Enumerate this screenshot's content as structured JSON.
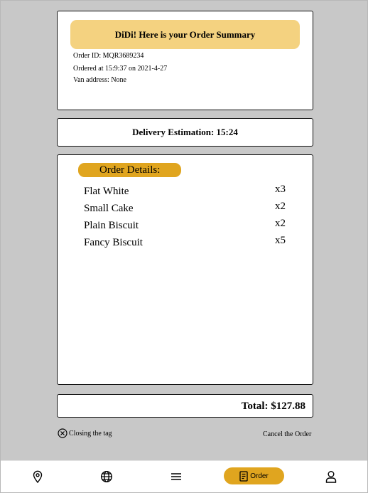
{
  "summary": {
    "title": "DiDi! Here is your Order Summary",
    "order_id": "Order ID: MQR3689234",
    "ordered_at": "Ordered at 15:9:37 on 2021-4-27",
    "van_address": "Van address: None"
  },
  "delivery": {
    "text": "Delivery Estimation: 15:24"
  },
  "details": {
    "heading": "Order Details:",
    "items": [
      {
        "name": "Flat White",
        "qty": "x3"
      },
      {
        "name": "Small Cake",
        "qty": "x2"
      },
      {
        "name": "Plain Biscuit",
        "qty": "x2"
      },
      {
        "name": "Fancy Biscuit",
        "qty": "x5"
      }
    ]
  },
  "total": {
    "text": "Total: $127.88"
  },
  "actions": {
    "closing_tag": "Closing the tag",
    "cancel_order": "Cancel the Order"
  },
  "nav": {
    "order_label": "Order",
    "icons": [
      "location-icon",
      "globe-icon",
      "menu-icon",
      "order-icon",
      "profile-icon"
    ]
  },
  "colors": {
    "background": "#c8c8c8",
    "banner": "#f4d280",
    "accent": "#e0a51f"
  }
}
